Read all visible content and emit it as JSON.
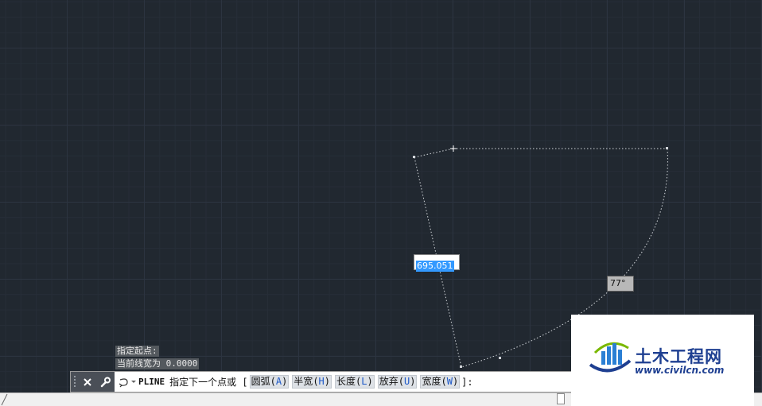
{
  "canvas": {
    "dynamic_input_value": "695.051",
    "angle_tooltip": "77°"
  },
  "command_history": [
    "指定起点:",
    "当前线宽为 0.0000"
  ],
  "command_line": {
    "command": "PLINE",
    "prompt": "指定下一个点或 [",
    "options": [
      {
        "label": "圆弧",
        "key": "A"
      },
      {
        "label": "半宽",
        "key": "H"
      },
      {
        "label": "长度",
        "key": "L"
      },
      {
        "label": "放弃",
        "key": "U"
      },
      {
        "label": "宽度",
        "key": "W"
      }
    ],
    "suffix": "]:"
  },
  "icons": {
    "close": "close-icon",
    "customize": "wrench-icon",
    "recent_commands": "command-prompt-icon"
  },
  "watermark": {
    "title": "土木工程网",
    "url": "www.civilcn.com"
  },
  "colors": {
    "background": "#212830",
    "highlight": "#3399ff",
    "option_key": "#1c58c8",
    "logo": "#1e3f91"
  }
}
